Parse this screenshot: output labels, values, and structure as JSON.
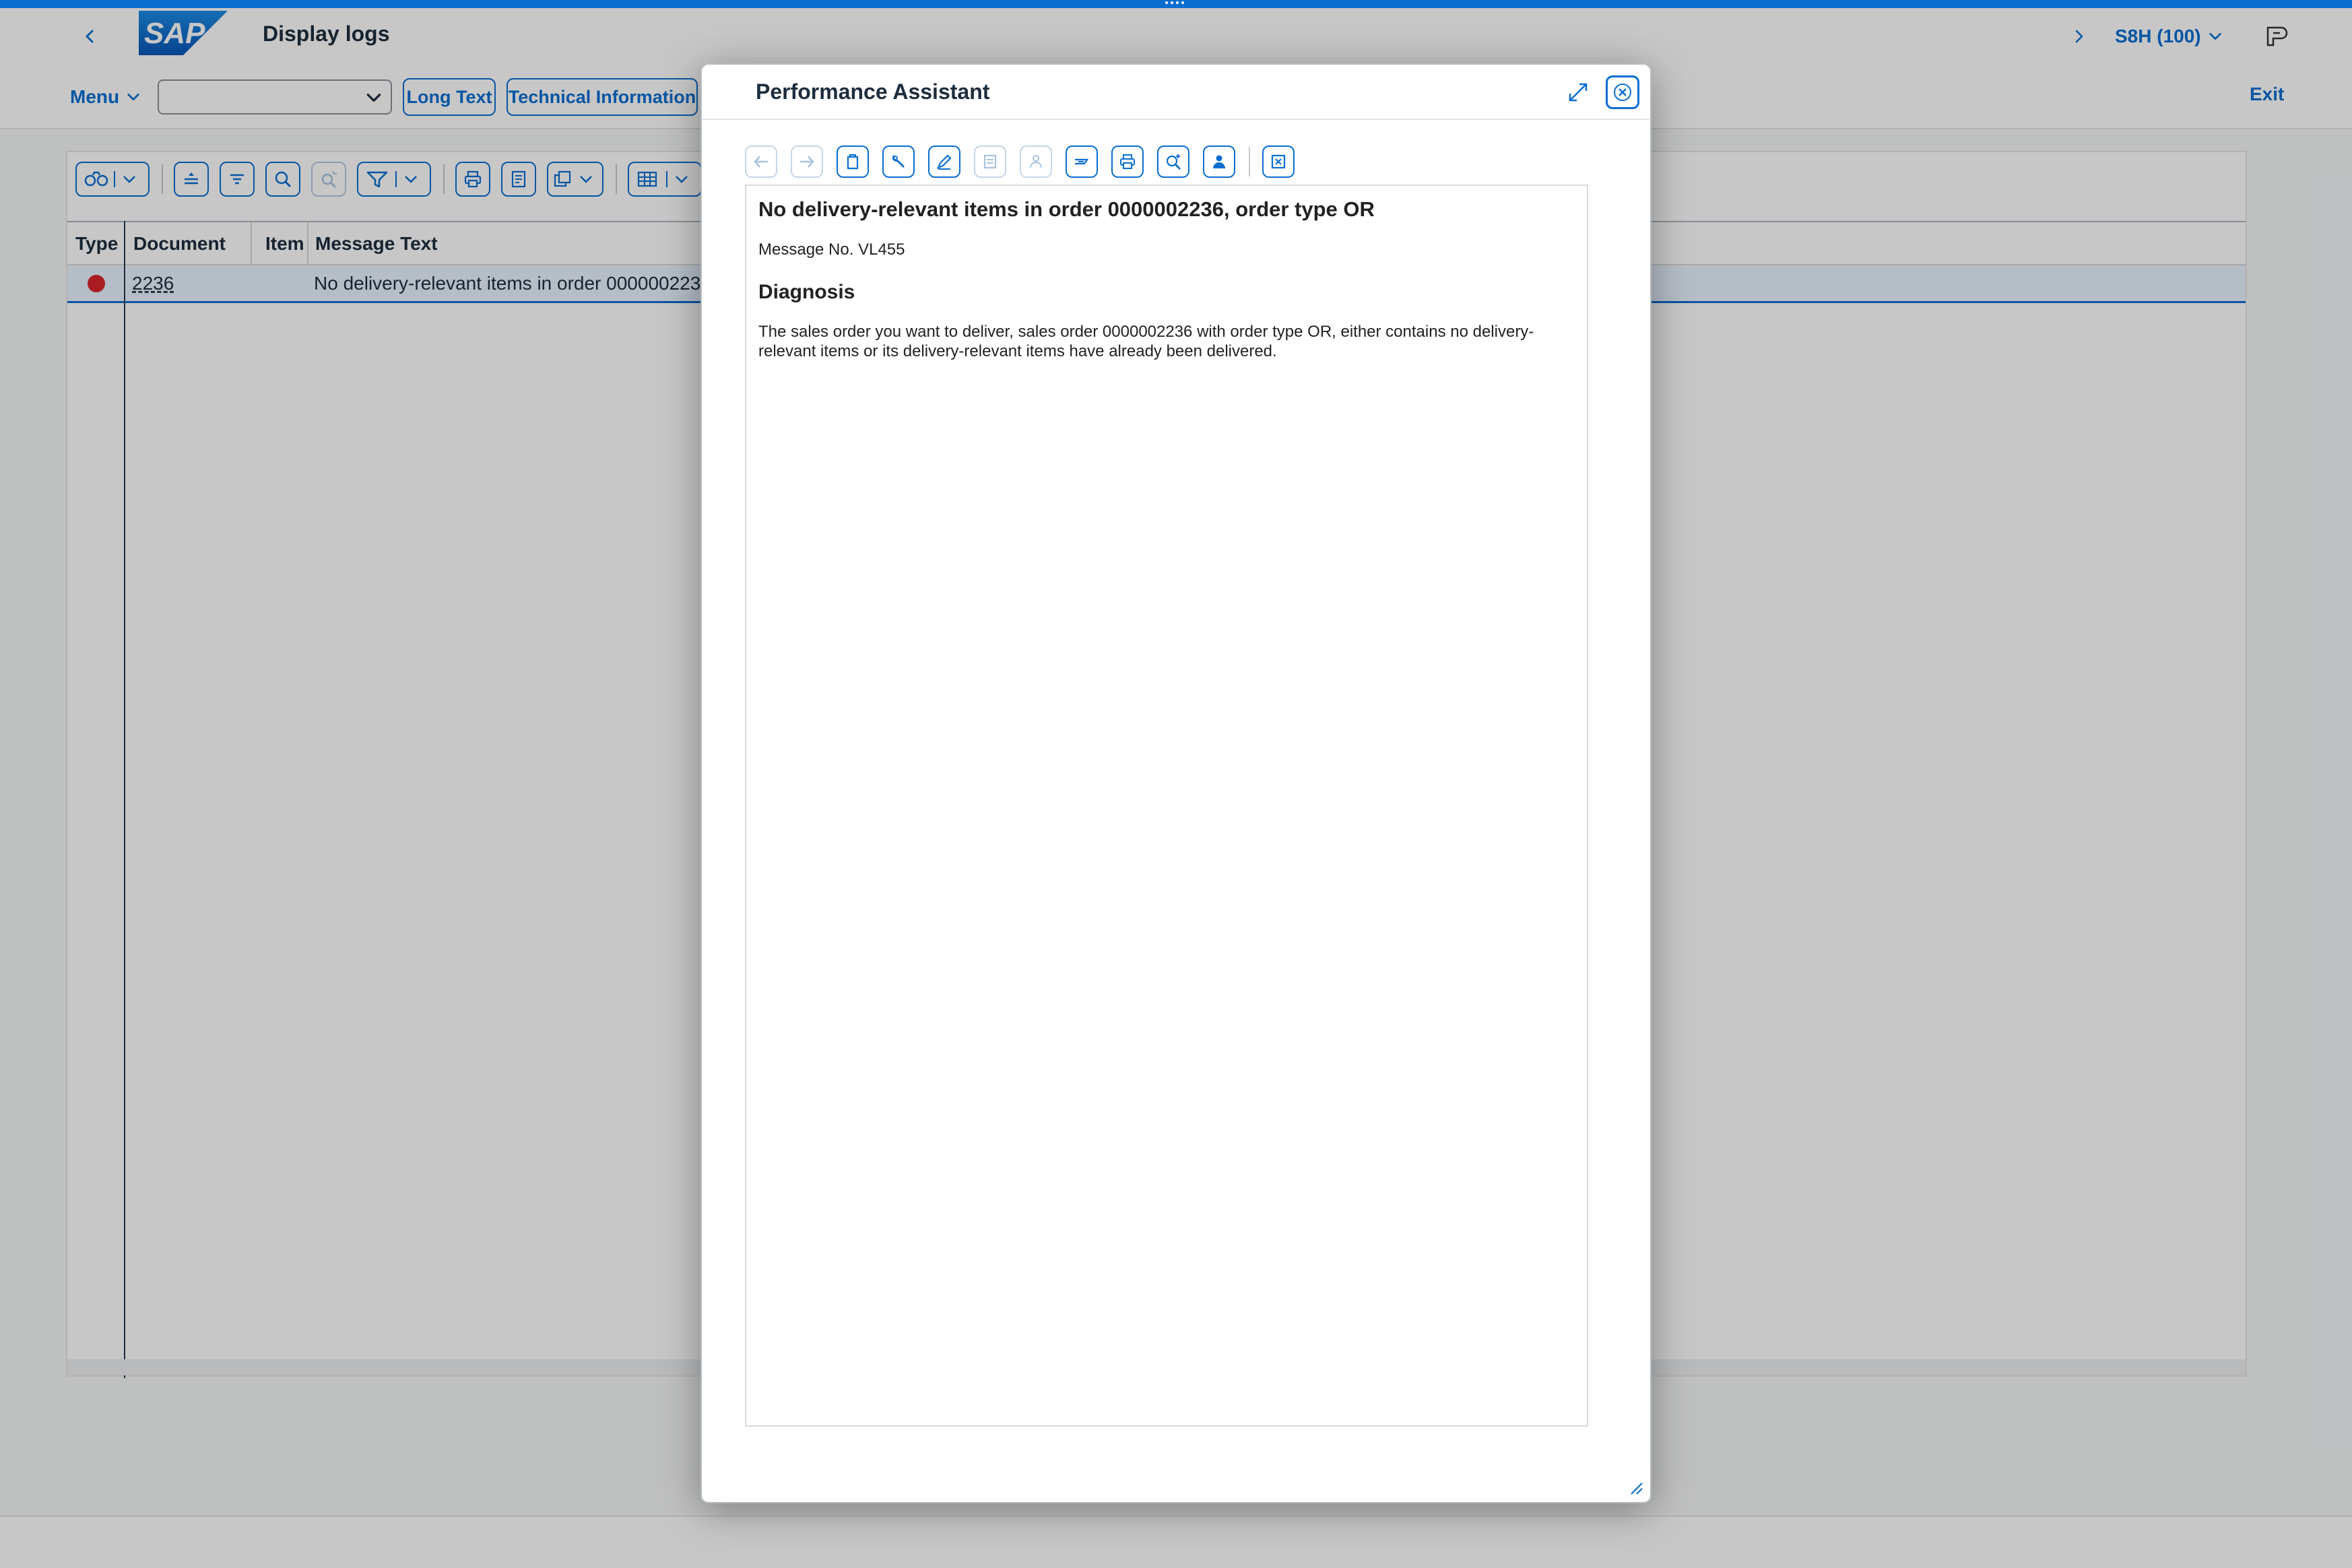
{
  "shell": {
    "title": "Display logs",
    "system": "S8H (100)",
    "logo_text": "SAP",
    "colors": {
      "accent": "#0a6ed1",
      "error": "#d9262c"
    }
  },
  "appbar": {
    "menu_label": "Menu",
    "command_value": "",
    "long_text_label": "Long Text",
    "technical_info_label": "Technical Information",
    "exit_label": "Exit"
  },
  "grid": {
    "columns": [
      "Type",
      "Document",
      "Item",
      "Message Text"
    ],
    "rows": [
      {
        "type": "error",
        "document": "2236",
        "item": "",
        "message": "No delivery-relevant items in order 0000002236"
      }
    ]
  },
  "dialog": {
    "title": "Performance Assistant",
    "toolbar_icons": [
      "arrow-left-icon",
      "arrow-right-icon",
      "copy-icon",
      "wrench-icon",
      "edit-icon",
      "document-icon",
      "share-icon",
      "bookmark-icon",
      "print-icon",
      "zoom-in-icon",
      "person-icon",
      "close-box-icon"
    ],
    "heading": "No delivery-relevant items in order 0000002236, order type OR",
    "message_no": "Message No. VL455",
    "section_title": "Diagnosis",
    "body": "The sales order you want to deliver, sales order 0000002236 with order type OR, either contains no delivery-relevant items or its delivery-relevant items have already been delivered."
  }
}
